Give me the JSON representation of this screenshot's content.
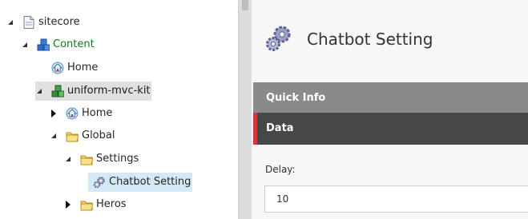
{
  "tree": {
    "nodes": [
      {
        "label": "sitecore",
        "icon": "page-icon",
        "toggle": "expanded"
      },
      {
        "label": "Content",
        "icon": "content-cubes-icon",
        "toggle": "expanded"
      },
      {
        "label": "Home",
        "icon": "home-icon",
        "toggle": "none"
      },
      {
        "label": "uniform-mvc-kit",
        "icon": "site-cubes-icon",
        "toggle": "expanded"
      },
      {
        "label": "Home",
        "icon": "home-icon",
        "toggle": "collapsed"
      },
      {
        "label": "Global",
        "icon": "folder-icon",
        "toggle": "expanded"
      },
      {
        "label": "Settings",
        "icon": "folder-icon",
        "toggle": "expanded"
      },
      {
        "label": "Chatbot Setting",
        "icon": "gears-icon",
        "toggle": "none"
      },
      {
        "label": "Heros",
        "icon": "folder-icon",
        "toggle": "collapsed"
      }
    ]
  },
  "content": {
    "title": "Chatbot Setting",
    "title_icon": "gears-icon",
    "sections": {
      "quick_info": "Quick Info",
      "data": "Data"
    },
    "fields": {
      "delay_label": "Delay:",
      "delay_value": "10"
    }
  },
  "colors": {
    "quick_info_bar": "#8a8a8a",
    "data_bar": "#474747",
    "data_accent": "#d13a3a",
    "selected_item_bg": "#d3e9f5",
    "content_green": "#137a13"
  }
}
